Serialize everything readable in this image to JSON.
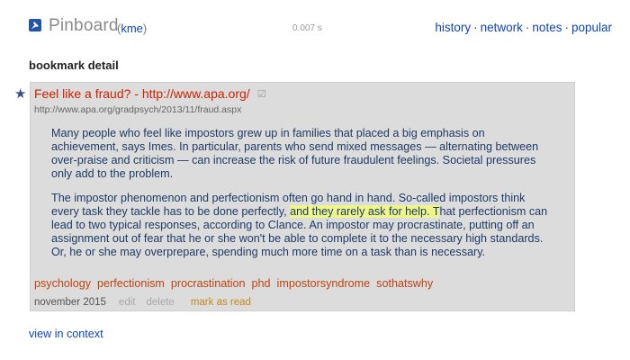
{
  "header": {
    "app_name": "Pinboard",
    "user_open": "(",
    "user": "kme",
    "user_close": ")",
    "timing": "0.007 s",
    "nav": [
      "history",
      "network",
      "notes",
      "popular"
    ],
    "nav_sep": "·"
  },
  "page_title": "bookmark detail",
  "bookmark": {
    "star": "★",
    "title": "Feel like a fraud? - http://www.apa.org/",
    "edit_icon": "☑",
    "url": "http://www.apa.org/gradpsych/2013/11/fraud.aspx",
    "description": {
      "p1": "Many people who feel like impostors grew up in families that placed a big emphasis on achievement, says Imes. In particular, parents who send mixed messages — alternating between over-praise and criticism — can increase the risk of future fraudulent feelings. Societal pressures only add to the problem.",
      "p2_before": "The impostor phenomenon and perfectionism often go hand in hand. So-called impostors think every task they tackle has to be done perfectly, ",
      "p2_highlight": "and they rarely ask for help. T",
      "p2_after": "hat perfectionism can lead to two typical responses, according to Clance. An impostor may procrastinate, putting off an assignment out of fear that he or she won't be able to complete it to the necessary high standards. Or, he or she may overprepare, spending much more time on a task than is necessary."
    },
    "tags": [
      "psychology",
      "perfectionism",
      "procrastination",
      "phd",
      "impostorsyndrome",
      "sothatswhy"
    ],
    "date": "november 2015",
    "edit_label": "edit",
    "delete_label": "delete",
    "mark_read_label": "mark as read"
  },
  "view_in_context": "view in context",
  "colors": {
    "title_red": "#cc2200",
    "link_blue": "#1144bb",
    "tag_orange": "#bb4411",
    "highlight": "#eef58a",
    "box_bg": "#dcdcdc"
  }
}
